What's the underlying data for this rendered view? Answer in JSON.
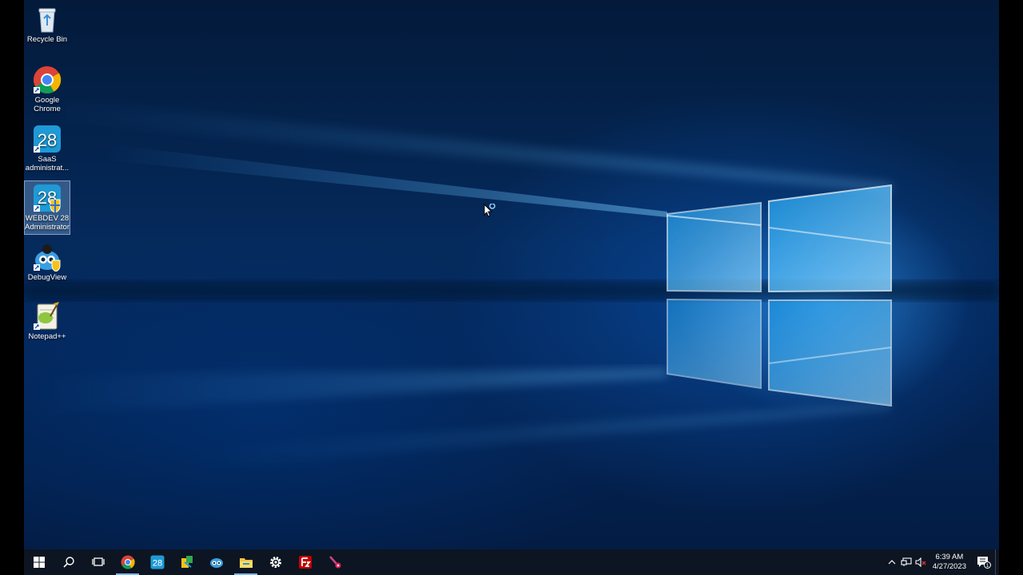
{
  "desktop": {
    "icons": [
      {
        "label": "Recycle Bin",
        "icon": "recycle-bin-icon"
      },
      {
        "label": "Google Chrome",
        "icon": "chrome-icon"
      },
      {
        "label": "SaaS administrat...",
        "icon": "webdev28-icon"
      },
      {
        "label": "WEBDEV 28 Administrator",
        "icon": "webdev28-admin-icon",
        "selected": true
      },
      {
        "label": "DebugView",
        "icon": "debugview-icon"
      },
      {
        "label": "Notepad++",
        "icon": "notepadpp-icon"
      }
    ],
    "badge_text": "28"
  },
  "taskbar": {
    "items": [
      {
        "icon": "windows-start-icon"
      },
      {
        "icon": "search-icon"
      },
      {
        "icon": "task-view-icon"
      },
      {
        "icon": "chrome-icon",
        "running": true
      },
      {
        "icon": "webdev28-icon"
      },
      {
        "icon": "tool-icon"
      },
      {
        "icon": "robot-icon"
      },
      {
        "icon": "file-explorer-icon",
        "running": true
      },
      {
        "icon": "settings-gear-icon"
      },
      {
        "icon": "filezilla-icon"
      },
      {
        "icon": "pin-tool-icon"
      }
    ],
    "clock": {
      "time": "6:39 AM",
      "date": "4/27/2023"
    },
    "notification_count": "1"
  },
  "colors": {
    "taskbar": "#0c1521",
    "accent": "#7ab7f0",
    "wallpaper_dark": "#031a3a",
    "wallpaper_glow": "#3aa8ff"
  }
}
